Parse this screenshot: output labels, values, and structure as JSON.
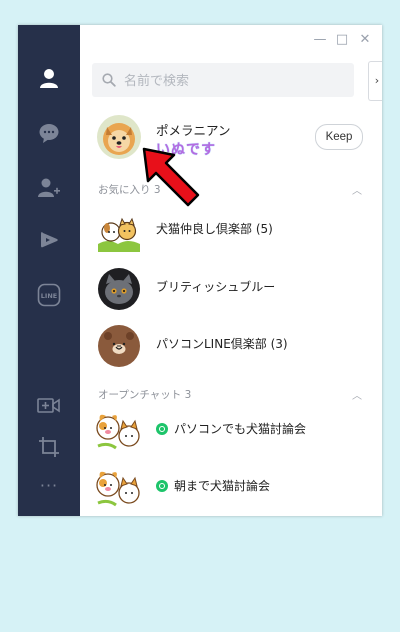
{
  "window": {
    "controls": {
      "minimize": "—",
      "maximize": "□",
      "close": "✕"
    }
  },
  "sidebar": {
    "items": [
      {
        "name": "friends",
        "icon": "person-icon"
      },
      {
        "name": "chats",
        "icon": "chat-bubble-icon"
      },
      {
        "name": "add-friend",
        "icon": "add-friend-icon"
      },
      {
        "name": "timeline",
        "icon": "play-icon"
      },
      {
        "name": "line",
        "icon": "line-logo-icon",
        "text": "LINE"
      }
    ],
    "bottom": [
      {
        "name": "video-call",
        "icon": "video-plus-icon"
      },
      {
        "name": "crop",
        "icon": "crop-icon"
      },
      {
        "name": "more",
        "icon": "ellipsis-icon",
        "text": "···"
      }
    ]
  },
  "search": {
    "placeholder": "名前で検索"
  },
  "side_tab": {
    "arrow": "›"
  },
  "profile": {
    "name": "ポメラニアン",
    "status": "いぬです",
    "keep_label": "Keep"
  },
  "favorites": {
    "header": "お気に入り 3",
    "items": [
      {
        "name": "犬猫仲良し倶楽部 (5)"
      },
      {
        "name": "ブリティッシュブルー"
      },
      {
        "name": "パソコンLINE倶楽部 (3)"
      }
    ]
  },
  "open_chats": {
    "header": "オープンチャット 3",
    "items": [
      {
        "name": "パソコンでも犬猫討論会"
      },
      {
        "name": "朝まで犬猫討論会"
      }
    ]
  },
  "colors": {
    "sidebar_bg": "#26304a",
    "accent_green": "#1dc46a",
    "arrow_red": "#e8101a",
    "page_bg": "#d6f2f6"
  }
}
